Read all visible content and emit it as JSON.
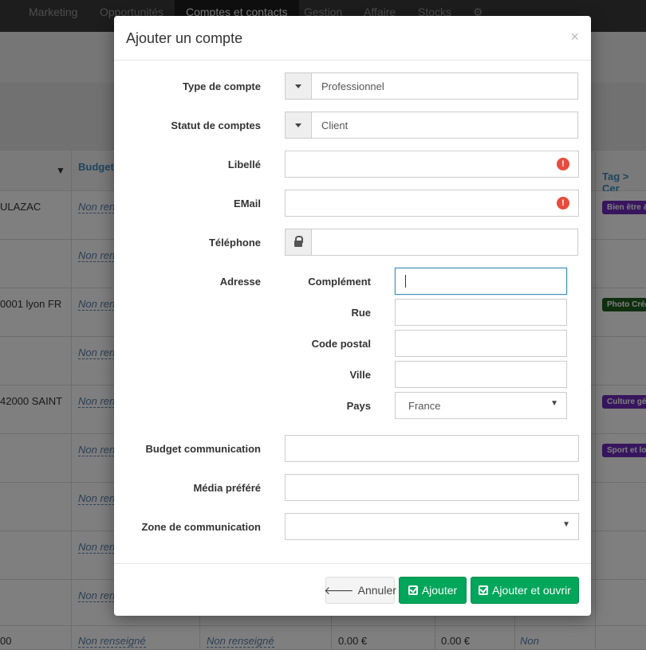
{
  "nav": {
    "items": [
      "Marketing",
      "Opportunités",
      "Comptes et contacts",
      "Gestion",
      "Affaire",
      "Stocks"
    ]
  },
  "table": {
    "headers": {
      "budget": "Budget",
      "tag": "Tag > Cer"
    },
    "rows": [
      {
        "address": "ULAZAC",
        "budget": "Non ren",
        "tag": "Bien être &"
      },
      {
        "address": "",
        "budget": "Non ren",
        "tag": ""
      },
      {
        "address": "0001 lyon FR",
        "budget": "Non ren",
        "tag": "Photo Créa"
      },
      {
        "address": "",
        "budget": "Non ren",
        "tag": ""
      },
      {
        "address": "42000 SAINT",
        "budget": "Non ren",
        "tag": "Culture gé"
      },
      {
        "address": "",
        "budget": "Non ren",
        "tag": "Sport et lo"
      },
      {
        "address": "",
        "budget": "Non ren",
        "tag": ""
      },
      {
        "address": "",
        "budget": "Non ren",
        "tag": ""
      },
      {
        "address": "",
        "budget": "Non ren",
        "tag": ""
      }
    ],
    "last_row": {
      "address": "00",
      "budget1": "Non renseigné",
      "budget2": "Non renseigné",
      "amount1": "0.00 €",
      "amount2": "0.00 €",
      "extra": "Non"
    },
    "colors": {
      "tag_purple": "#6f2dbd",
      "tag_green": "#1e5e1e"
    }
  },
  "modal": {
    "title": "Ajouter un compte",
    "close": "×",
    "fields": {
      "account_type": {
        "label": "Type de compte",
        "value": "Professionnel"
      },
      "account_status": {
        "label": "Statut de comptes",
        "value": "Client"
      },
      "libelle": {
        "label": "Libellé",
        "value": ""
      },
      "email": {
        "label": "EMail",
        "value": ""
      },
      "phone": {
        "label": "Téléphone",
        "value": ""
      },
      "address": {
        "label": "Adresse",
        "complement": {
          "label": "Complément",
          "value": ""
        },
        "street": {
          "label": "Rue",
          "value": ""
        },
        "postal_code": {
          "label": "Code postal",
          "value": ""
        },
        "city": {
          "label": "Ville",
          "value": ""
        },
        "country": {
          "label": "Pays",
          "value": "France"
        }
      },
      "budget": {
        "label": "Budget communication",
        "value": ""
      },
      "media": {
        "label": "Média préféré",
        "value": ""
      },
      "zone": {
        "label": "Zone de communication",
        "value": ""
      }
    },
    "buttons": {
      "cancel": "Annuler",
      "add": "Ajouter",
      "add_open": "Ajouter et ouvrir"
    },
    "colors": {
      "success": "#00a65a",
      "error": "#e74c3c",
      "focus": "#3c8dbc"
    }
  }
}
